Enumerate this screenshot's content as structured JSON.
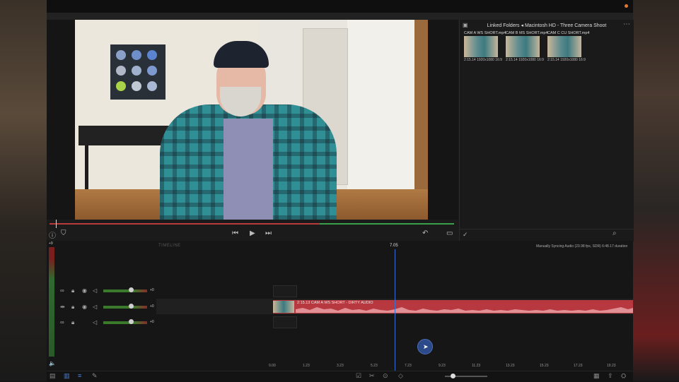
{
  "browser": {
    "title": "Linked Folders ◂ Macintosh HD - Three Camera Shoot",
    "clips": [
      {
        "name": "CAM A WS SHORT.mp4",
        "duration": "2:15.14",
        "resolution": "1920x1080",
        "aspect": "16:9"
      },
      {
        "name": "CAM B MS SHORT.mp4",
        "duration": "2:15.14",
        "resolution": "1920x1080",
        "aspect": "16:9"
      },
      {
        "name": "CAM C CU SHORT.mp4",
        "duration": "2:15.14",
        "resolution": "1920x1080",
        "aspect": "16:9"
      }
    ]
  },
  "timeline": {
    "label": "TIMELINE",
    "status": "Manually Syncing Audio (23.98 fps, SDR) 6:48.17 duration",
    "playhead_time": "7.05",
    "meter_top": "+9",
    "tracks": [
      {
        "gain": "+0"
      },
      {
        "gain": "+0"
      },
      {
        "gain": "+0"
      }
    ],
    "clip": {
      "time": "2:15.13",
      "label": "CAM A WS SHORT - DIRTY AUDIO"
    },
    "ruler": [
      "0.00",
      "1.23",
      "3.23",
      "5.23",
      "7.23",
      "9.23",
      "11.23",
      "13.23",
      "15.23",
      "17.23",
      "19.23"
    ]
  },
  "icons": {
    "rewind": "⏮",
    "play": "▶",
    "forward": "⏭",
    "info": "ⓘ",
    "marker": "⛉",
    "undo": "↶",
    "display": "▭",
    "more": "⋯",
    "search": "⌕",
    "check": "✓",
    "link": "🔗",
    "lock": "🔒",
    "eye": "👁",
    "speaker": "🔈",
    "scissors": "✂"
  },
  "colors": {
    "clip": "#b8383f",
    "playhead": "#3a6ed0",
    "progress_red": "#b83a3a",
    "progress_green": "#3aa04a",
    "record": "#e0792a"
  }
}
